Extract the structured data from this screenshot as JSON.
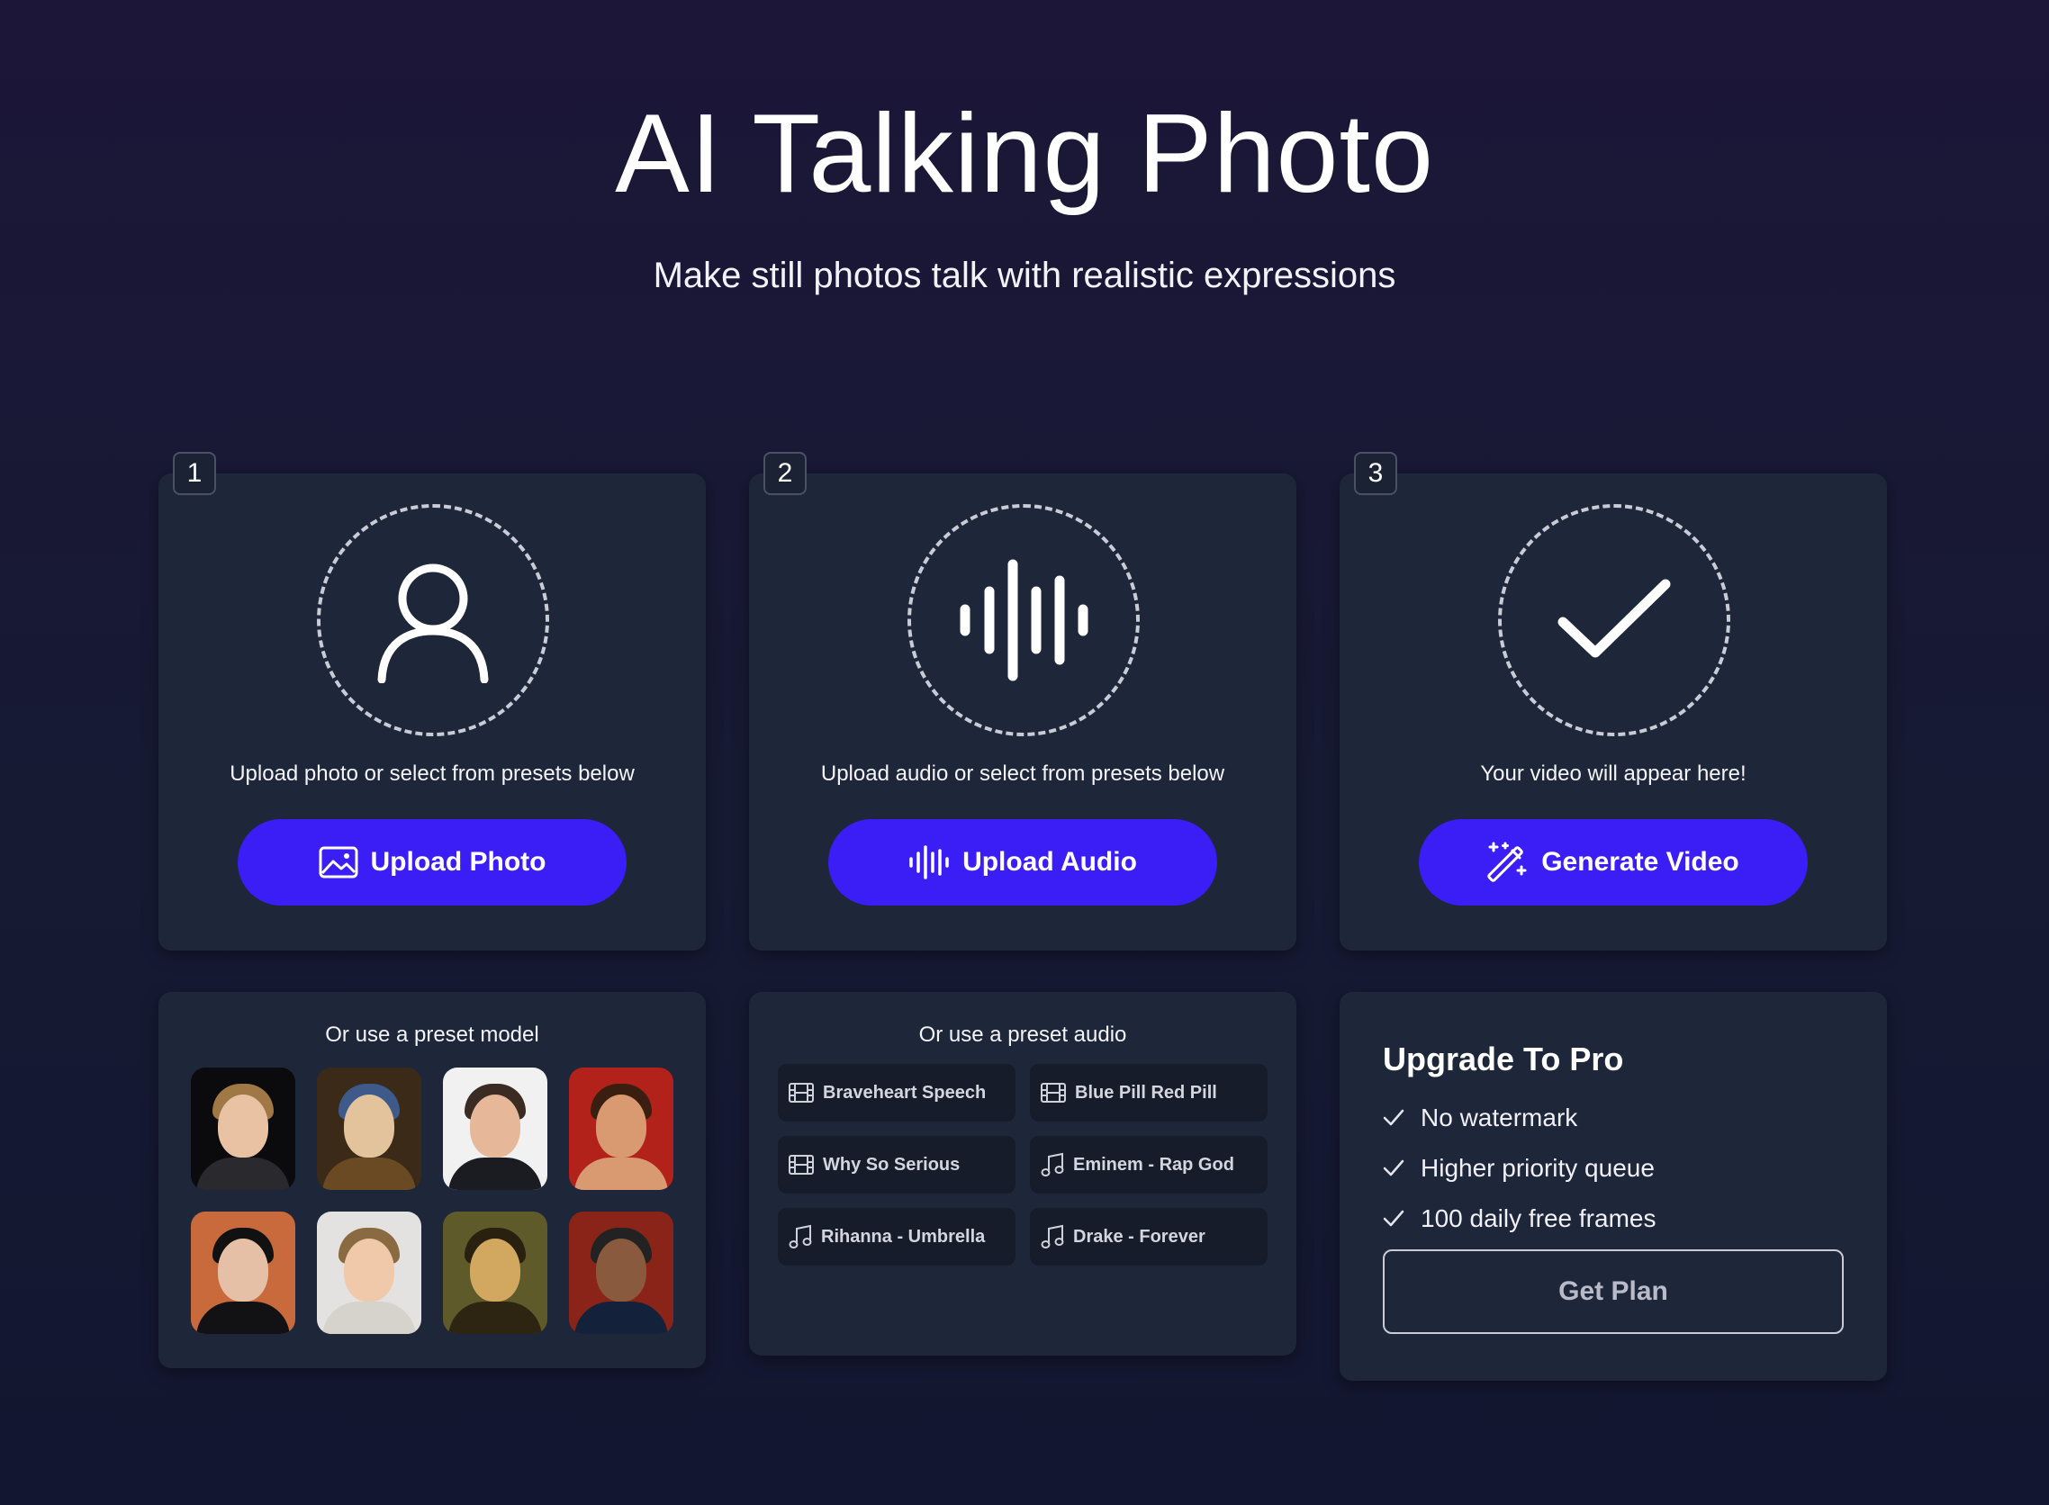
{
  "header": {
    "title": "AI Talking Photo",
    "subtitle": "Make still photos talk with realistic expressions"
  },
  "steps": [
    {
      "number": "1",
      "text": "Upload photo or select from presets below",
      "button_label": "Upload Photo",
      "icon": "user-icon",
      "button_icon": "image-icon"
    },
    {
      "number": "2",
      "text": "Upload audio or select from presets below",
      "button_label": "Upload Audio",
      "icon": "waveform-icon",
      "button_icon": "waveform-icon"
    },
    {
      "number": "3",
      "text": "Your video will appear here!",
      "button_label": "Generate Video",
      "icon": "checkmark-icon",
      "button_icon": "magic-wand-icon"
    }
  ],
  "preset_models": {
    "title": "Or use a preset model",
    "count": 8
  },
  "preset_audio": {
    "title": "Or use a preset audio",
    "items": [
      {
        "label": "Braveheart Speech",
        "icon": "film-icon"
      },
      {
        "label": "Blue Pill Red Pill",
        "icon": "film-icon"
      },
      {
        "label": "Why So Serious",
        "icon": "film-icon"
      },
      {
        "label": "Eminem - Rap God",
        "icon": "music-note-icon"
      },
      {
        "label": "Rihanna - Umbrella",
        "icon": "music-note-icon"
      },
      {
        "label": "Drake - Forever",
        "icon": "music-note-icon"
      }
    ]
  },
  "upgrade": {
    "title": "Upgrade To Pro",
    "features": [
      "No watermark",
      "Higher priority queue",
      "100 daily free frames"
    ],
    "button_label": "Get Plan"
  },
  "colors": {
    "accent": "#3b1df5",
    "card": "#1e2639",
    "background": "#1a1733"
  }
}
